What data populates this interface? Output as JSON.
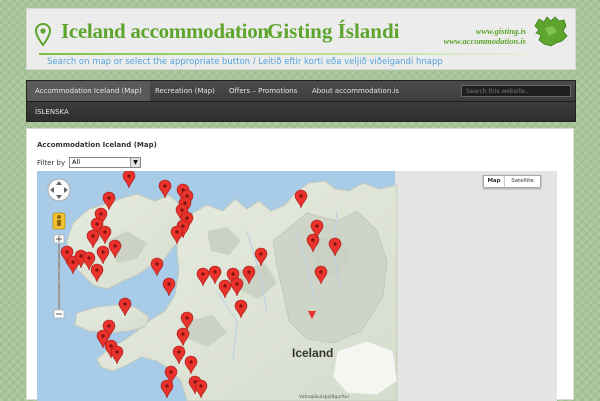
{
  "header": {
    "title": "Iceland accommodation",
    "title_is": "Gisting Íslandi",
    "domains": [
      "www.gisting.is",
      "www.accommodation.is"
    ],
    "tagline": "Search on map or select the appropriate button / Leitið eftir korti eða veljið viðeigandi hnapp",
    "brand_color": "#5da52c",
    "tagline_color": "#57a3dc"
  },
  "nav": {
    "items": [
      {
        "label": "Accommodation Iceland (Map)",
        "active": true
      },
      {
        "label": "Recreation (Map)",
        "active": false
      },
      {
        "label": "Offers – Promotions",
        "active": false
      },
      {
        "label": "About accommodation.is",
        "active": false
      }
    ],
    "second_row": [
      "ÍSLENSKA"
    ],
    "search_placeholder": "Search this website..."
  },
  "page": {
    "title": "Accommodation Iceland (Map)",
    "filter_label": "Filter by",
    "filter_value": "All"
  },
  "map": {
    "label": "Iceland",
    "type_buttons": [
      "Map",
      "Satellite"
    ],
    "selected_type": "Map",
    "credit": "Vatnajökulsþjóðgarður",
    "marker_color": "#e8322b",
    "marker_count": 49
  }
}
